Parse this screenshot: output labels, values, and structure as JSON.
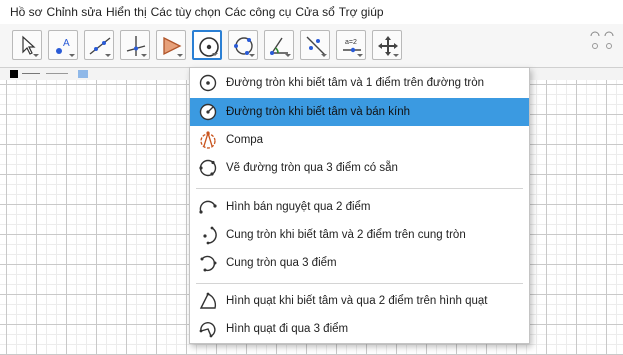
{
  "menubar": {
    "items": [
      "Hồ sơ",
      "Chỉnh sửa",
      "Hiển thị",
      "Các tùy chọn",
      "Các công cụ",
      "Cửa sổ",
      "Trợ giúp"
    ]
  },
  "toolbar": {
    "tools": [
      "move-tool",
      "point-tool",
      "line-tool",
      "perpendicular-tool",
      "polygon-tool",
      "circle-tool",
      "circle-three-points-tool",
      "angle-tool",
      "reflect-tool",
      "slider-tool",
      "move-view-tool"
    ],
    "active_tool": "circle-tool"
  },
  "stylebar": {
    "color": "#000000"
  },
  "dropdown": {
    "items": [
      {
        "label": "Đường tròn khi biết tâm và 1 điểm trên đường tròn",
        "icon": "circle-center-point-icon"
      },
      {
        "label": "Đường tròn khi biết tâm và bán kính",
        "icon": "circle-center-radius-icon",
        "highlighted": true
      },
      {
        "label": "Compa",
        "icon": "compass-icon"
      },
      {
        "label": "Vẽ đường tròn qua 3 điểm có sẵn",
        "icon": "circle-three-points-icon"
      },
      {
        "label": "Hình bán nguyệt qua 2 điểm",
        "icon": "semicircle-icon"
      },
      {
        "label": "Cung tròn khi biết tâm và 2 điểm trên cung tròn",
        "icon": "arc-center-icon"
      },
      {
        "label": "Cung tròn qua 3 điểm",
        "icon": "arc-three-points-icon"
      },
      {
        "label": "Hình quạt khi biết tâm và qua 2 điểm trên hình quạt",
        "icon": "sector-center-icon"
      },
      {
        "label": "Hình quạt đi qua 3 điểm",
        "icon": "sector-three-points-icon"
      }
    ],
    "highlight_color": "#3b9ae1"
  }
}
